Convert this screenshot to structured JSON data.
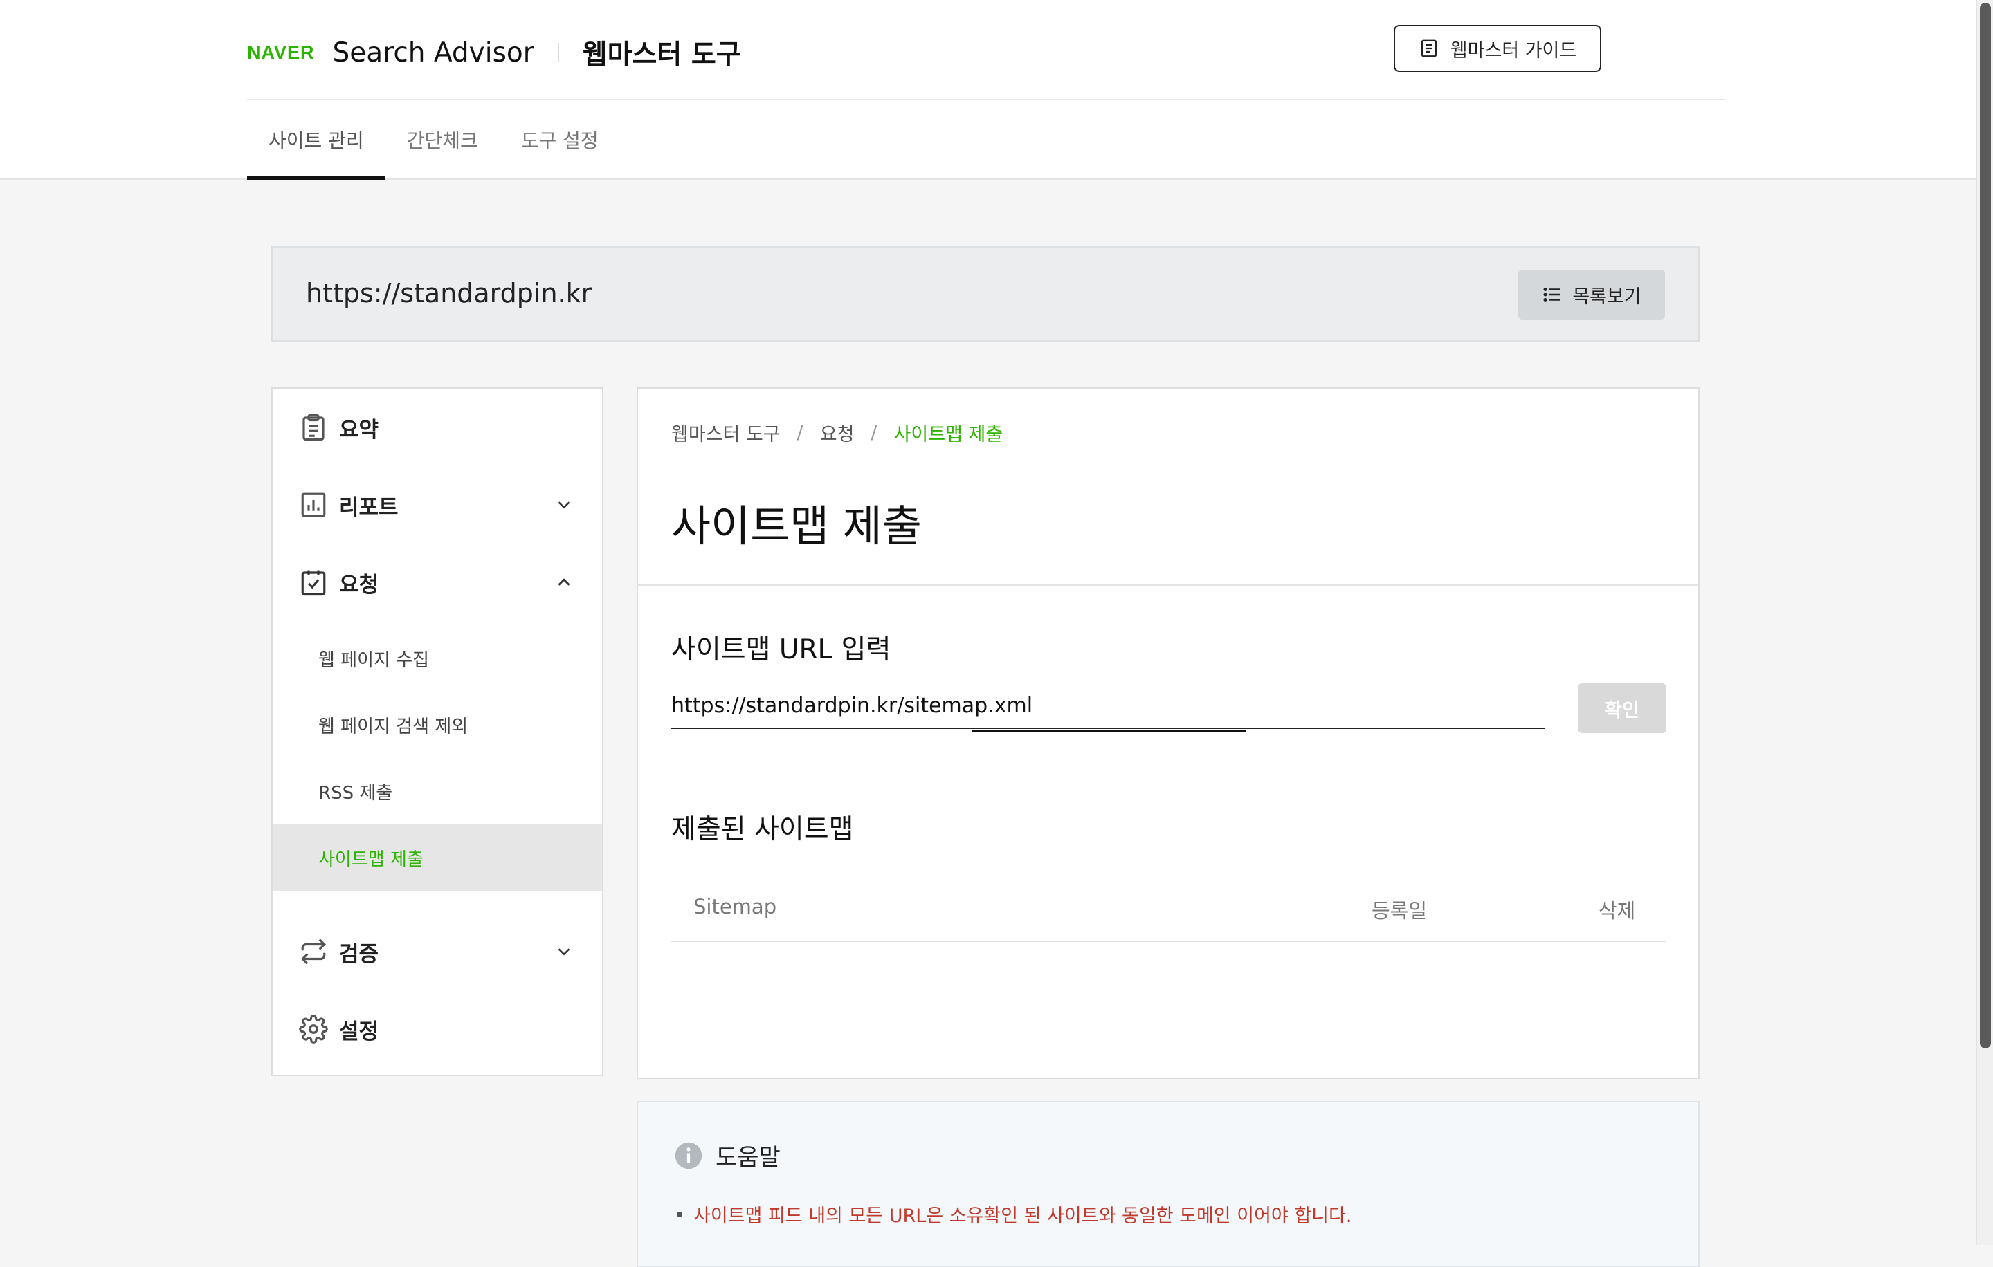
{
  "header": {
    "logo_text": "NAVER",
    "brand": "Search Advisor",
    "tool_title": "웹마스터 도구",
    "guide_button": "웹마스터 가이드",
    "tabs": [
      {
        "label": "사이트 관리",
        "active": true
      },
      {
        "label": "간단체크",
        "active": false
      },
      {
        "label": "도구 설정",
        "active": false
      }
    ]
  },
  "site_bar": {
    "url": "https://standardpin.kr",
    "list_button": "목록보기"
  },
  "sidebar": {
    "menu": [
      {
        "label": "요약",
        "icon": "clipboard-icon"
      },
      {
        "label": "리포트",
        "icon": "bar-chart-icon",
        "expanded": false
      },
      {
        "label": "요청",
        "icon": "checklist-icon",
        "expanded": true
      },
      {
        "label": "검증",
        "icon": "repeat-icon",
        "expanded": false
      },
      {
        "label": "설정",
        "icon": "gear-icon"
      }
    ],
    "submenu": [
      {
        "label": "웹 페이지 수집"
      },
      {
        "label": "웹 페이지 검색 제외"
      },
      {
        "label": "RSS 제출"
      },
      {
        "label": "사이트맵 제출",
        "active": true
      }
    ]
  },
  "main": {
    "breadcrumb": [
      "웹마스터 도구",
      "요청",
      "사이트맵 제출"
    ],
    "title": "사이트맵 제출",
    "input_section_title": "사이트맵 URL 입력",
    "url_input_value": "https://standardpin.kr/sitemap.xml",
    "confirm_button": "확인",
    "submitted_title": "제출된 사이트맵",
    "table_headers": [
      "Sitemap",
      "등록일",
      "삭제"
    ]
  },
  "help": {
    "title": "도움말",
    "items": [
      "사이트맵 피드 내의 모든 URL은 소유확인 된 사이트와 동일한 도메인 이어야 합니다."
    ]
  },
  "colors": {
    "accent_green": "#2db400",
    "warning_red": "#c0392b"
  }
}
